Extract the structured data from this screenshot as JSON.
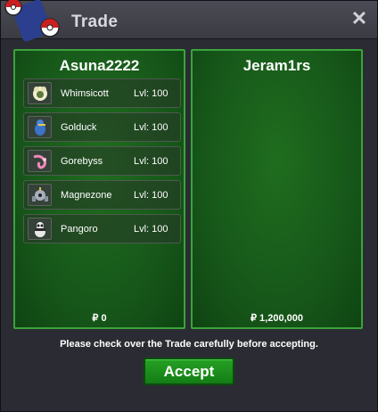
{
  "window": {
    "title": "Trade"
  },
  "left": {
    "player": "Asuna2222",
    "money": "₽ 0",
    "pokemon": [
      {
        "name": "Whimsicott",
        "level": "Lvl: 100",
        "icon": "whimsicott-sprite-icon"
      },
      {
        "name": "Golduck",
        "level": "Lvl: 100",
        "icon": "golduck-sprite-icon"
      },
      {
        "name": "Gorebyss",
        "level": "Lvl: 100",
        "icon": "gorebyss-sprite-icon"
      },
      {
        "name": "Magnezone",
        "level": "Lvl: 100",
        "icon": "magnezone-sprite-icon"
      },
      {
        "name": "Pangoro",
        "level": "Lvl: 100",
        "icon": "pangoro-sprite-icon"
      }
    ]
  },
  "right": {
    "player": "Jeram1rs",
    "money": "₽ 1,200,000"
  },
  "footer": {
    "notice": "Please check over the Trade carefully before accepting.",
    "accept_label": "Accept"
  },
  "colors": {
    "panel": "#17581a",
    "panel_border": "#3aa43a",
    "accept": "#1c8f1d"
  }
}
